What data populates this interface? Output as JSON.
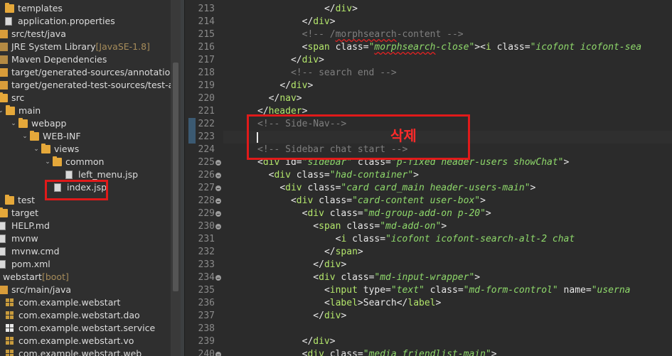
{
  "explorer": {
    "rows": [
      {
        "label": "templates",
        "icon": "folder-icon"
      },
      {
        "label": "application.properties",
        "icon": "properties-file-icon"
      },
      {
        "label": "src/test/java",
        "icon": "source-folder-icon"
      },
      {
        "label": "JRE System Library",
        "decoration": "[JavaSE-1.8]",
        "icon": "library-icon"
      },
      {
        "label": "Maven Dependencies",
        "icon": "library-icon"
      },
      {
        "label": "target/generated-sources/annotations",
        "icon": "source-folder-icon"
      },
      {
        "label": "target/generated-test-sources/test-annotat",
        "icon": "source-folder-icon"
      },
      {
        "label": "src",
        "icon": "folder-icon"
      },
      {
        "label": "main",
        "icon": "folder-icon"
      },
      {
        "label": "webapp",
        "icon": "folder-icon"
      },
      {
        "label": "WEB-INF",
        "icon": "folder-icon"
      },
      {
        "label": "views",
        "icon": "folder-icon"
      },
      {
        "label": "common",
        "icon": "folder-icon"
      },
      {
        "label": "left_menu.jsp",
        "icon": "jsp-file-icon"
      },
      {
        "label": "index.jsp",
        "icon": "jsp-file-icon"
      },
      {
        "label": "test",
        "icon": "folder-icon"
      },
      {
        "label": "target",
        "icon": "folder-icon"
      },
      {
        "label": "HELP.md",
        "icon": "file-icon"
      },
      {
        "label": "mvnw",
        "icon": "file-icon"
      },
      {
        "label": "mvnw.cmd",
        "icon": "file-icon"
      },
      {
        "label": "pom.xml",
        "icon": "xml-file-icon"
      },
      {
        "label": "webstart",
        "decoration": "[boot]",
        "icon": "project-icon"
      },
      {
        "label": "src/main/java",
        "icon": "source-folder-icon"
      },
      {
        "label": "com.example.webstart",
        "icon": "package-icon"
      },
      {
        "label": "com.example.webstart.dao",
        "icon": "package-icon"
      },
      {
        "label": "com.example.webstart.service",
        "icon": "package-icon"
      },
      {
        "label": "com.example.webstart.vo",
        "icon": "package-icon"
      },
      {
        "label": "com.example.webstart.web",
        "icon": "package-icon"
      }
    ]
  },
  "editor": {
    "line_numbers": [
      "213",
      "214",
      "215",
      "216",
      "217",
      "218",
      "219",
      "220",
      "221",
      "222",
      "223",
      "224",
      "225",
      "226",
      "227",
      "228",
      "229",
      "230",
      "231",
      "232",
      "233",
      "234",
      "235",
      "236",
      "237",
      "238",
      "239",
      "240"
    ],
    "lines": [
      [
        {
          "t": "</",
          "c": "tag"
        },
        {
          "t": "div",
          "c": "nm"
        },
        {
          "t": ">",
          "c": "tag"
        }
      ],
      [
        {
          "t": "</",
          "c": "tag"
        },
        {
          "t": "div",
          "c": "nm"
        },
        {
          "t": ">",
          "c": "tag"
        }
      ],
      [
        {
          "t": "<!-- /",
          "c": "cm"
        },
        {
          "t": "morphsearch",
          "c": "cm uw"
        },
        {
          "t": "-content -->",
          "c": "cm"
        }
      ],
      [
        {
          "t": "<",
          "c": "tag"
        },
        {
          "t": "span",
          "c": "nm"
        },
        {
          "t": " class=",
          "c": "at"
        },
        {
          "t": "\"",
          "c": "val"
        },
        {
          "t": "morphsearch",
          "c": "val uw"
        },
        {
          "t": "-close\"",
          "c": "val"
        },
        {
          "t": "><",
          "c": "tag"
        },
        {
          "t": "i",
          "c": "nm"
        },
        {
          "t": " class=",
          "c": "at"
        },
        {
          "t": "\"icofont icofont-sea",
          "c": "val"
        }
      ],
      [
        {
          "t": "</",
          "c": "tag"
        },
        {
          "t": "div",
          "c": "nm"
        },
        {
          "t": ">",
          "c": "tag"
        }
      ],
      [
        {
          "t": "<!-- search end -->",
          "c": "cm"
        }
      ],
      [
        {
          "t": "</",
          "c": "tag"
        },
        {
          "t": "div",
          "c": "nm"
        },
        {
          "t": ">",
          "c": "tag"
        }
      ],
      [
        {
          "t": "</",
          "c": "tag"
        },
        {
          "t": "nav",
          "c": "nm"
        },
        {
          "t": ">",
          "c": "tag"
        }
      ],
      [
        {
          "t": "</",
          "c": "tag"
        },
        {
          "t": "header",
          "c": "nm"
        },
        {
          "t": ">",
          "c": "tag"
        }
      ],
      [
        {
          "t": "<!-- Side-Nav-->",
          "c": "cm"
        }
      ],
      [],
      [
        {
          "t": "<!-- Sidebar chat start -->",
          "c": "cm"
        }
      ],
      [
        {
          "t": "<",
          "c": "tag"
        },
        {
          "t": "div",
          "c": "nm"
        },
        {
          "t": " id=",
          "c": "at"
        },
        {
          "t": "\"sidebar\"",
          "c": "val"
        },
        {
          "t": " class=",
          "c": "at"
        },
        {
          "t": "\"p-fixed header-users showChat\"",
          "c": "val"
        },
        {
          "t": ">",
          "c": "tag"
        }
      ],
      [
        {
          "t": "<",
          "c": "tag"
        },
        {
          "t": "div",
          "c": "nm"
        },
        {
          "t": " class=",
          "c": "at"
        },
        {
          "t": "\"had-container\"",
          "c": "val"
        },
        {
          "t": ">",
          "c": "tag"
        }
      ],
      [
        {
          "t": "<",
          "c": "tag"
        },
        {
          "t": "div",
          "c": "nm"
        },
        {
          "t": " class=",
          "c": "at"
        },
        {
          "t": "\"card card_main header-users-main\"",
          "c": "val"
        },
        {
          "t": ">",
          "c": "tag"
        }
      ],
      [
        {
          "t": "<",
          "c": "tag"
        },
        {
          "t": "div",
          "c": "nm"
        },
        {
          "t": " class=",
          "c": "at"
        },
        {
          "t": "\"card-content user-box\"",
          "c": "val"
        },
        {
          "t": ">",
          "c": "tag"
        }
      ],
      [
        {
          "t": "<",
          "c": "tag"
        },
        {
          "t": "div",
          "c": "nm"
        },
        {
          "t": " class=",
          "c": "at"
        },
        {
          "t": "\"md-group-add-on p-20\"",
          "c": "val"
        },
        {
          "t": ">",
          "c": "tag"
        }
      ],
      [
        {
          "t": "<",
          "c": "tag"
        },
        {
          "t": "span",
          "c": "nm"
        },
        {
          "t": " class=",
          "c": "at"
        },
        {
          "t": "\"md-add-on\"",
          "c": "val"
        },
        {
          "t": ">",
          "c": "tag"
        }
      ],
      [
        {
          "t": "<",
          "c": "tag"
        },
        {
          "t": "i",
          "c": "nm"
        },
        {
          "t": " class=",
          "c": "at"
        },
        {
          "t": "\"icofont icofont-search-alt-2 chat",
          "c": "val"
        }
      ],
      [
        {
          "t": "</",
          "c": "tag"
        },
        {
          "t": "span",
          "c": "nm"
        },
        {
          "t": ">",
          "c": "tag"
        }
      ],
      [
        {
          "t": "</",
          "c": "tag"
        },
        {
          "t": "div",
          "c": "nm"
        },
        {
          "t": ">",
          "c": "tag"
        }
      ],
      [
        {
          "t": "<",
          "c": "tag"
        },
        {
          "t": "div",
          "c": "nm"
        },
        {
          "t": " class=",
          "c": "at"
        },
        {
          "t": "\"md-input-wrapper\"",
          "c": "val"
        },
        {
          "t": ">",
          "c": "tag"
        }
      ],
      [
        {
          "t": "<",
          "c": "tag"
        },
        {
          "t": "input",
          "c": "nm"
        },
        {
          "t": " type=",
          "c": "at"
        },
        {
          "t": "\"text\"",
          "c": "val"
        },
        {
          "t": " class=",
          "c": "at"
        },
        {
          "t": "\"md-form-control\"",
          "c": "val"
        },
        {
          "t": " name=",
          "c": "at"
        },
        {
          "t": "\"userna",
          "c": "val"
        }
      ],
      [
        {
          "t": "<",
          "c": "tag"
        },
        {
          "t": "label",
          "c": "nm"
        },
        {
          "t": ">",
          "c": "tag"
        },
        {
          "t": "Search",
          "c": "txt"
        },
        {
          "t": "</",
          "c": "tag"
        },
        {
          "t": "label",
          "c": "nm"
        },
        {
          "t": ">",
          "c": "tag"
        }
      ],
      [
        {
          "t": "</",
          "c": "tag"
        },
        {
          "t": "div",
          "c": "nm"
        },
        {
          "t": ">",
          "c": "tag"
        }
      ],
      [],
      [
        {
          "t": "</",
          "c": "tag"
        },
        {
          "t": "div",
          "c": "nm"
        },
        {
          "t": ">",
          "c": "tag"
        }
      ],
      [
        {
          "t": "<",
          "c": "tag"
        },
        {
          "t": "div",
          "c": "nm"
        },
        {
          "t": " class=",
          "c": "at"
        },
        {
          "t": "\"media friendlist-main\"",
          "c": "val"
        },
        {
          "t": ">",
          "c": "tag"
        }
      ]
    ]
  },
  "annotation": {
    "label": "삭제",
    "color": "#e01a1a"
  }
}
